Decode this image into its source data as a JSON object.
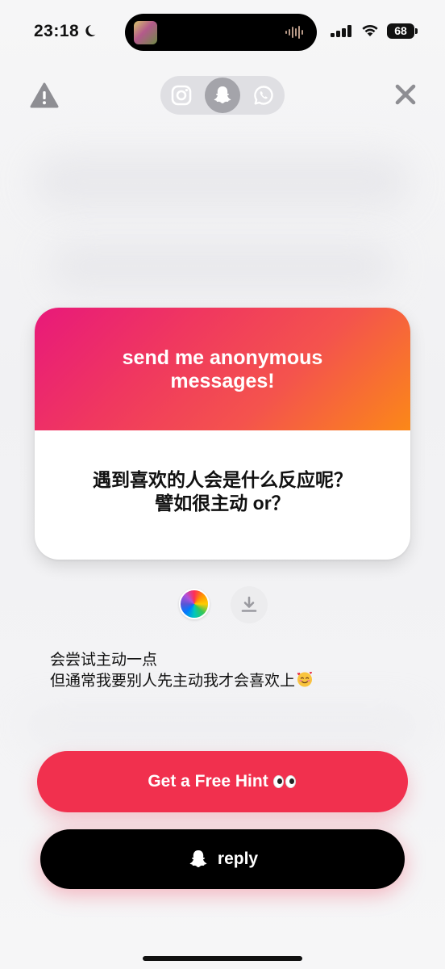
{
  "status_bar": {
    "time": "23:18",
    "battery": "68"
  },
  "icons": {
    "warning": "warning-triangle-icon",
    "instagram": "instagram-icon",
    "snapchat": "snapchat-ghost-icon",
    "whatsapp": "whatsapp-icon",
    "close": "close-icon",
    "download": "download-icon"
  },
  "share_switcher": {
    "active": "snapchat"
  },
  "card": {
    "header": "send me anonymous messages!",
    "question_line1": "遇到喜欢的人会是什么反应呢？",
    "question_line2": "譬如很主动 or？",
    "gradient_start": "#e8197a",
    "gradient_end": "#fb8818"
  },
  "answer": {
    "line1": "会尝试主动一点",
    "line2": "但通常我要别人先主动我才会喜欢上"
  },
  "buttons": {
    "hint_label": "Get a Free Hint",
    "reply_label": "reply"
  },
  "colors": {
    "hint_button": "#f1304e",
    "reply_button": "#000000"
  }
}
